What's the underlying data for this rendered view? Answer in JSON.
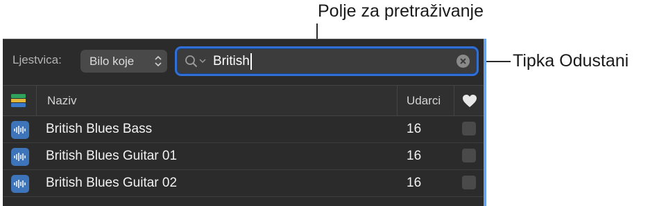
{
  "callouts": {
    "search_field": "Polje za pretraživanje",
    "cancel_button": "Tipka Odustani"
  },
  "filter": {
    "scale_label": "Ljestvica:",
    "scale_value": "Bilo koje",
    "search_value": "British"
  },
  "table": {
    "columns": {
      "name": "Naziv",
      "beats": "Udarci"
    },
    "rows": [
      {
        "name": "British Blues Bass",
        "beats": "16",
        "favorite": false
      },
      {
        "name": "British Blues Guitar 01",
        "beats": "16",
        "favorite": false
      },
      {
        "name": "British Blues Guitar 02",
        "beats": "16",
        "favorite": false
      }
    ]
  },
  "icons": {
    "row_icon": "waveform-icon",
    "color_column": "color-stripes-icon",
    "favorite_column": "heart-icon",
    "search": "magnifier-icon",
    "cancel": "clear-circle-icon"
  },
  "colors": {
    "accent": "#2f6fd6",
    "row_icon": "#3e74b9",
    "panel": "#2b2b2b"
  }
}
